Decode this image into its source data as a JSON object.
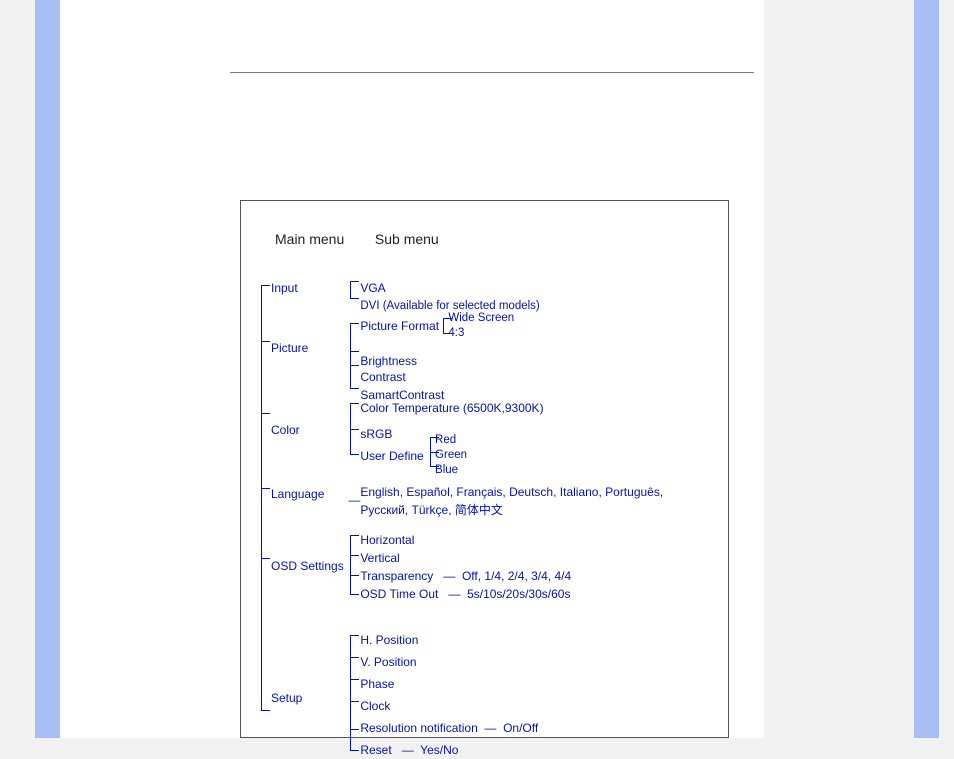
{
  "headers": {
    "main": "Main menu",
    "sub": "Sub menu"
  },
  "menu": {
    "input": {
      "label": "Input",
      "items": [
        "VGA",
        "DVI (Available for selected models)"
      ]
    },
    "picture": {
      "label": "Picture",
      "format_label": "Picture Format",
      "format_opts": [
        "Wide Screen",
        "4:3"
      ],
      "items": [
        "Brightness",
        "Contrast",
        "SamartContrast"
      ]
    },
    "color": {
      "label": "Color",
      "temp": "Color Temperature (6500K,9300K)",
      "srgb": "sRGB",
      "userdef": "User Define",
      "userdef_opts": [
        "Red",
        "Green",
        "Blue"
      ]
    },
    "language": {
      "label": "Language",
      "text": "English, Español, Français, Deutsch, Italiano, Português, Русский, Türkçe, 简体中文"
    },
    "osd": {
      "label": "OSD Settings",
      "items": [
        "Horizontal",
        "Vertical"
      ],
      "transparency_label": "Transparency",
      "transparency_values": "Off, 1/4, 2/4, 3/4, 4/4",
      "timeout_label": "OSD Time Out",
      "timeout_values": "5s/10s/20s/30s/60s"
    },
    "setup": {
      "label": "Setup",
      "items": [
        "H. Position",
        "V. Position",
        "Phase",
        "Clock"
      ],
      "resnotif_label": "Resolution notification",
      "resnotif_values": "On/Off",
      "reset_label": "Reset",
      "reset_values": "Yes/No"
    }
  }
}
